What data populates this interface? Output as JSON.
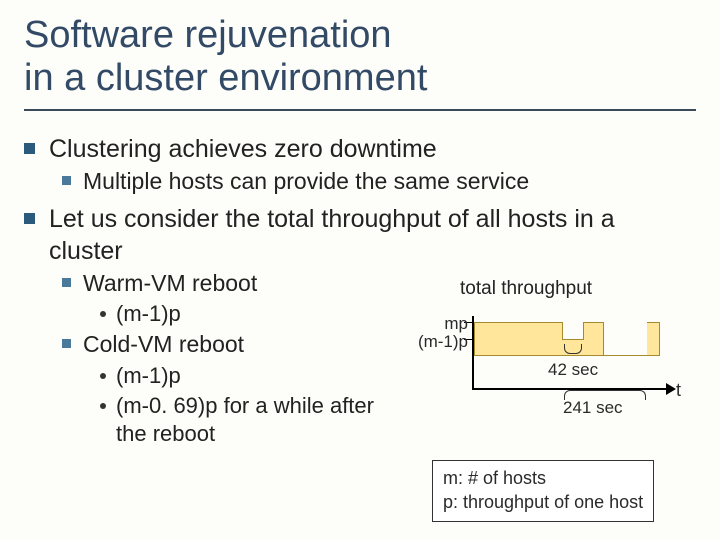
{
  "title": "Software rejuvenation\nin a cluster environment",
  "b1": "Clustering achieves zero downtime",
  "b1_1": "Multiple hosts can provide the same service",
  "b2": "Let us consider the total throughput of all hosts in a cluster",
  "b2_1": "Warm-VM reboot",
  "b2_1_1": "(m-1)p",
  "b2_2": "Cold-VM reboot",
  "b2_2_1": "(m-1)p",
  "b2_2_2": "(m-0. 69)p for a while after the reboot",
  "chart_title": "total throughput",
  "y_mp": "mp",
  "y_m1p": "(m-1)p",
  "t42": "42 sec",
  "t241": "241 sec",
  "t_axis": "t",
  "legend_m": "m:  # of hosts",
  "legend_p": "p:  throughput of one host",
  "chart_data": {
    "type": "line",
    "title": "total throughput",
    "xlabel": "t",
    "ylabel": "",
    "y_ticks": [
      "mp",
      "(m-1)p"
    ],
    "series": [
      {
        "name": "Warm-VM reboot",
        "dip_level": "(m-1)p",
        "dip_duration_sec": 42
      },
      {
        "name": "Cold-VM reboot",
        "dip_level": "(m-1)p then (m-0.69)p",
        "dip_duration_sec": 241
      }
    ],
    "legend": [
      "m: # of hosts",
      "p: throughput of one host"
    ]
  }
}
